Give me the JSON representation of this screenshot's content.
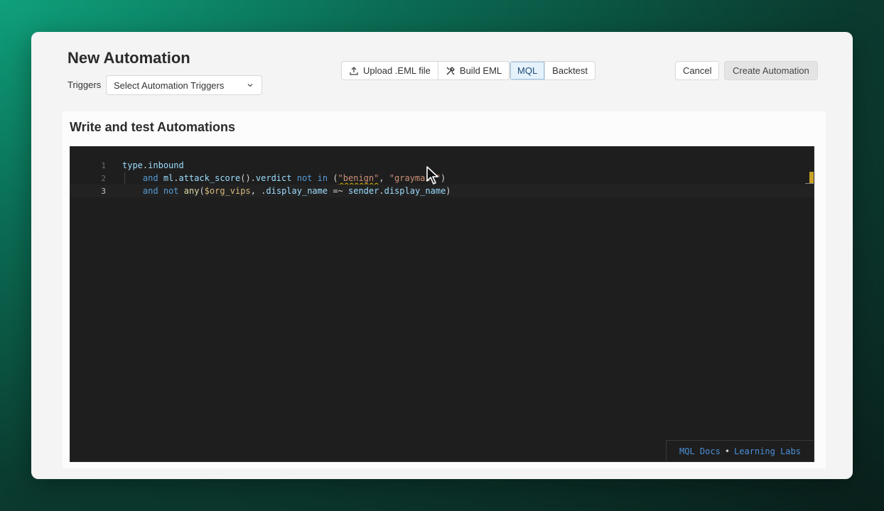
{
  "header": {
    "title": "New Automation",
    "triggers_label": "Triggers",
    "triggers_select": "Select Automation Triggers"
  },
  "toolbar": {
    "upload_label": "Upload .EML file",
    "build_label": "Build EML",
    "mql_label": "MQL",
    "backtest_label": "Backtest",
    "active_tab": "MQL",
    "cancel_label": "Cancel",
    "create_label": "Create Automation"
  },
  "panel": {
    "title": "Write and test Automations"
  },
  "editor": {
    "line_numbers": [
      "1",
      "2",
      "3"
    ],
    "active_line": 3,
    "lines": [
      "type.inbound",
      "    and ml.attack_score().verdict not in (\"benign\", \"graymail\")",
      "    and not any($org_vips, .display_name =~ sender.display_name)"
    ]
  },
  "footer": {
    "docs_label": "MQL Docs",
    "separator": "•",
    "labs_label": "Learning Labs"
  },
  "colors": {
    "accent_link": "#4a8fd8",
    "keyword": "#569cd6",
    "string": "#ce9178",
    "variable": "#d7ba7d",
    "editor_bg": "#1e1e1e"
  }
}
